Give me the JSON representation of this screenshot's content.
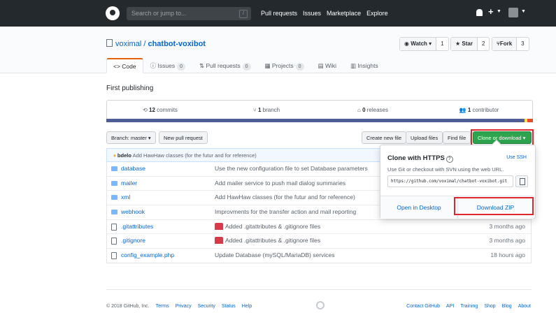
{
  "header": {
    "search_placeholder": "Search or jump to...",
    "search_shortcut": "/",
    "nav": [
      "Pull requests",
      "Issues",
      "Marketplace",
      "Explore"
    ]
  },
  "repo": {
    "owner": "voximal",
    "separator": " / ",
    "name": "chatbot-voxibot",
    "watch_label": "Watch ▾",
    "watch_count": "1",
    "star_label": "★ Star",
    "star_count": "2",
    "fork_label": "Fork",
    "fork_count": "3",
    "tabs": [
      {
        "label": "Code",
        "count": ""
      },
      {
        "label": "Issues",
        "count": "0"
      },
      {
        "label": "Pull requests",
        "count": "0"
      },
      {
        "label": "Projects",
        "count": "0"
      },
      {
        "label": "Wiki",
        "count": ""
      },
      {
        "label": "Insights",
        "count": ""
      }
    ],
    "description": "First publishing"
  },
  "summary": {
    "commits": "12",
    "commits_label": "commits",
    "branch": "1",
    "branch_label": "branch",
    "releases": "0",
    "releases_label": "releases",
    "contributors": "1",
    "contributors_label": "contributor"
  },
  "langbar_colors": [
    "#4F5D95",
    "#4F5D95",
    "#f1e05a",
    "#e34c26"
  ],
  "toolbar": {
    "branch": "Branch: master ▾",
    "new_pr": "New pull request",
    "create_file": "Create new file",
    "upload": "Upload files",
    "find": "Find file",
    "clone": "Clone or download ▾"
  },
  "latest_commit": {
    "author": "bdelo",
    "message": "Add HawHaw classes (for the futur and for reference)"
  },
  "files": [
    {
      "type": "dir",
      "name": "database",
      "message": "Use the new configuration file to set Database parameters",
      "age": ""
    },
    {
      "type": "dir",
      "name": "mailer",
      "message": "Add mailer service to push mail dialog summaries",
      "age": ""
    },
    {
      "type": "dir",
      "name": "xml",
      "message": "Add HawHaw classes (for the futur and for reference)",
      "age": ""
    },
    {
      "type": "dir",
      "name": "webhook",
      "message": "Improvments for the transfer action and mail reporting",
      "age": ""
    },
    {
      "type": "file",
      "name": ".gitattributes",
      "message": "Added .gitattributes & .gitignore files",
      "age": "3 months ago"
    },
    {
      "type": "file",
      "name": ".gitignore",
      "message": "Added .gitattributes & .gitignore files",
      "age": "3 months ago"
    },
    {
      "type": "file",
      "name": "config_example.php",
      "message": "Update Database (mySQL/MariaDB) services",
      "age": "18 hours ago"
    }
  ],
  "clone_popup": {
    "title": "Clone with HTTPS",
    "help": "?",
    "use_ssh": "Use SSH",
    "description": "Use Git or checkout with SVN using the web URL.",
    "url": "https://github.com/voximal/chatbot-voxibot.git",
    "open_desktop": "Open in Desktop",
    "download_zip": "Download ZIP"
  },
  "footer": {
    "copyright": "© 2018 GitHub, Inc.",
    "left_links": [
      "Terms",
      "Privacy",
      "Security",
      "Status",
      "Help"
    ],
    "right_links": [
      "Contact GitHub",
      "API",
      "Training",
      "Shop",
      "Blog",
      "About"
    ]
  },
  "colors": {
    "highlight": "#e0252d",
    "clone_button": "#2ea44f",
    "header": "#24292e"
  }
}
